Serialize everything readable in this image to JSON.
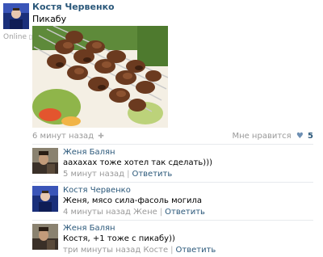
{
  "post": {
    "author": "Костя Червенко",
    "text": "Пикабу",
    "online_label": "Online",
    "time": "6 минут назад",
    "like_label": "Мне нравится",
    "like_count": "5"
  },
  "comments": [
    {
      "author": "Женя Балян",
      "text": "аахахах тоже хотел так сделать)))",
      "time": "5 минут назад",
      "reply_label": "Ответить"
    },
    {
      "author": "Костя Червенко",
      "text": "Женя, мясо сила-фасоль могила",
      "time": "4 минуты назад Жене",
      "reply_label": "Ответить"
    },
    {
      "author": "Женя Балян",
      "text": "Костя, +1 тоже с пикабу))",
      "time": "три минуты назад Косте",
      "reply_label": "Ответить"
    }
  ],
  "colors": {
    "link": "#2b587a",
    "meta": "#999999",
    "divider": "#e7eaed"
  }
}
